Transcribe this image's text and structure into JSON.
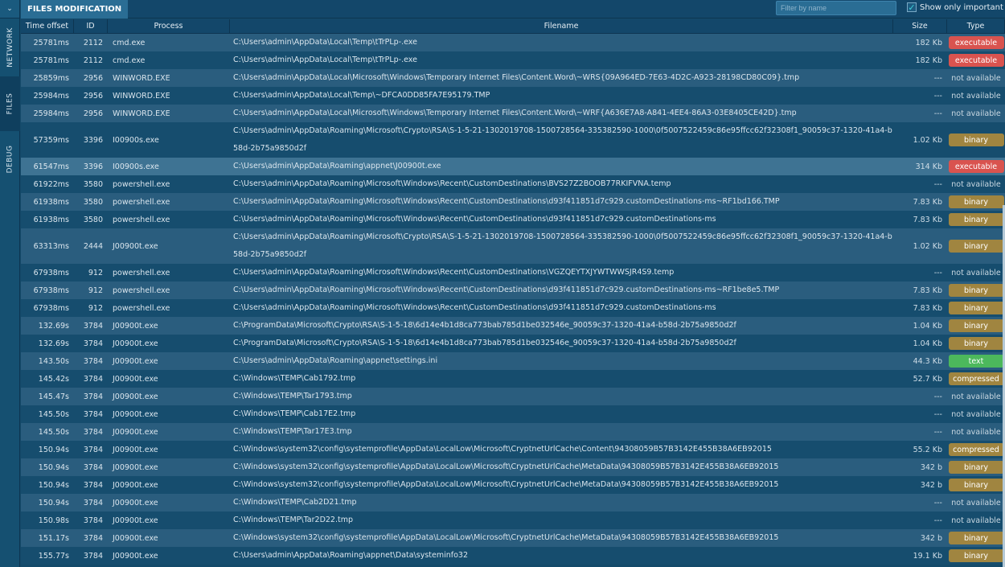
{
  "sidebar": {
    "collapse_icon": "chevron-down-icon",
    "tabs": [
      {
        "label": "NETWORK",
        "active": false
      },
      {
        "label": "FILES",
        "active": true
      },
      {
        "label": "DEBUG",
        "active": false
      }
    ]
  },
  "toolbar": {
    "tab_label": "FILES MODIFICATION",
    "filter_placeholder": "Filter by name",
    "filter_value": "",
    "show_important_label": "Show only important",
    "show_important_checked": true
  },
  "table": {
    "columns": [
      "Time offset",
      "ID",
      "Process",
      "Filename",
      "Size",
      "Type"
    ],
    "badge_colors": {
      "executable": "#d9534f",
      "binary": "#a08540",
      "compressed": "#a08540",
      "text": "#4cb85c"
    },
    "rows": [
      {
        "time": "25781ms",
        "id": "2112",
        "process": "cmd.exe",
        "filename": "C:\\Users\\admin\\AppData\\Local\\Temp\\tTrPLp-.exe",
        "size": "182 Kb",
        "type": "executable"
      },
      {
        "time": "25781ms",
        "id": "2112",
        "process": "cmd.exe",
        "filename": "C:\\Users\\admin\\AppData\\Local\\Temp\\tTrPLp-.exe",
        "size": "182 Kb",
        "type": "executable"
      },
      {
        "time": "25859ms",
        "id": "2956",
        "process": "WINWORD.EXE",
        "filename": "C:\\Users\\admin\\AppData\\Local\\Microsoft\\Windows\\Temporary Internet Files\\Content.Word\\~WRS{09A964ED-7E63-4D2C-A923-28198CD80C09}.tmp",
        "size": "---",
        "type": "not available"
      },
      {
        "time": "25984ms",
        "id": "2956",
        "process": "WINWORD.EXE",
        "filename": "C:\\Users\\admin\\AppData\\Local\\Temp\\~DFCA0DD85FA7E95179.TMP",
        "size": "---",
        "type": "not available"
      },
      {
        "time": "25984ms",
        "id": "2956",
        "process": "WINWORD.EXE",
        "filename": "C:\\Users\\admin\\AppData\\Local\\Microsoft\\Windows\\Temporary Internet Files\\Content.Word\\~WRF{A636E7A8-A841-4EE4-86A3-03E8405CE42D}.tmp",
        "size": "---",
        "type": "not available"
      },
      {
        "time": "57359ms",
        "id": "3396",
        "process": "I00900s.exe",
        "filename": "C:\\Users\\admin\\AppData\\Roaming\\Microsoft\\Crypto\\RSA\\S-1-5-21-1302019708-1500728564-335382590-1000\\0f5007522459c86e95ffcc62f32308f1_90059c37-1320-41a4-b58d-2b75a9850d2f",
        "size": "1.02 Kb",
        "type": "binary",
        "tall": true
      },
      {
        "time": "61547ms",
        "id": "3396",
        "process": "I00900s.exe",
        "filename": "C:\\Users\\admin\\AppData\\Roaming\\appnet\\J00900t.exe",
        "size": "314 Kb",
        "type": "executable",
        "selected": true
      },
      {
        "time": "61922ms",
        "id": "3580",
        "process": "powershell.exe",
        "filename": "C:\\Users\\admin\\AppData\\Roaming\\Microsoft\\Windows\\Recent\\CustomDestinations\\BVS27Z2BOOB77RKIFVNA.temp",
        "size": "---",
        "type": "not available"
      },
      {
        "time": "61938ms",
        "id": "3580",
        "process": "powershell.exe",
        "filename": "C:\\Users\\admin\\AppData\\Roaming\\Microsoft\\Windows\\Recent\\CustomDestinations\\d93f411851d7c929.customDestinations-ms~RF1bd166.TMP",
        "size": "7.83 Kb",
        "type": "binary"
      },
      {
        "time": "61938ms",
        "id": "3580",
        "process": "powershell.exe",
        "filename": "C:\\Users\\admin\\AppData\\Roaming\\Microsoft\\Windows\\Recent\\CustomDestinations\\d93f411851d7c929.customDestinations-ms",
        "size": "7.83 Kb",
        "type": "binary"
      },
      {
        "time": "63313ms",
        "id": "2444",
        "process": "J00900t.exe",
        "filename": "C:\\Users\\admin\\AppData\\Roaming\\Microsoft\\Crypto\\RSA\\S-1-5-21-1302019708-1500728564-335382590-1000\\0f5007522459c86e95ffcc62f32308f1_90059c37-1320-41a4-b58d-2b75a9850d2f",
        "size": "1.02 Kb",
        "type": "binary",
        "tall": true
      },
      {
        "time": "67938ms",
        "id": "912",
        "process": "powershell.exe",
        "filename": "C:\\Users\\admin\\AppData\\Roaming\\Microsoft\\Windows\\Recent\\CustomDestinations\\VGZQEYTXJYWTWWSJR4S9.temp",
        "size": "---",
        "type": "not available"
      },
      {
        "time": "67938ms",
        "id": "912",
        "process": "powershell.exe",
        "filename": "C:\\Users\\admin\\AppData\\Roaming\\Microsoft\\Windows\\Recent\\CustomDestinations\\d93f411851d7c929.customDestinations-ms~RF1be8e5.TMP",
        "size": "7.83 Kb",
        "type": "binary"
      },
      {
        "time": "67938ms",
        "id": "912",
        "process": "powershell.exe",
        "filename": "C:\\Users\\admin\\AppData\\Roaming\\Microsoft\\Windows\\Recent\\CustomDestinations\\d93f411851d7c929.customDestinations-ms",
        "size": "7.83 Kb",
        "type": "binary"
      },
      {
        "time": "132.69s",
        "id": "3784",
        "process": "J00900t.exe",
        "filename": "C:\\ProgramData\\Microsoft\\Crypto\\RSA\\S-1-5-18\\6d14e4b1d8ca773bab785d1be032546e_90059c37-1320-41a4-b58d-2b75a9850d2f",
        "size": "1.04 Kb",
        "type": "binary"
      },
      {
        "time": "132.69s",
        "id": "3784",
        "process": "J00900t.exe",
        "filename": "C:\\ProgramData\\Microsoft\\Crypto\\RSA\\S-1-5-18\\6d14e4b1d8ca773bab785d1be032546e_90059c37-1320-41a4-b58d-2b75a9850d2f",
        "size": "1.04 Kb",
        "type": "binary"
      },
      {
        "time": "143.50s",
        "id": "3784",
        "process": "J00900t.exe",
        "filename": "C:\\Users\\admin\\AppData\\Roaming\\appnet\\settings.ini",
        "size": "44.3 Kb",
        "type": "text"
      },
      {
        "time": "145.42s",
        "id": "3784",
        "process": "J00900t.exe",
        "filename": "C:\\Windows\\TEMP\\Cab1792.tmp",
        "size": "52.7 Kb",
        "type": "compressed"
      },
      {
        "time": "145.47s",
        "id": "3784",
        "process": "J00900t.exe",
        "filename": "C:\\Windows\\TEMP\\Tar1793.tmp",
        "size": "---",
        "type": "not available"
      },
      {
        "time": "145.50s",
        "id": "3784",
        "process": "J00900t.exe",
        "filename": "C:\\Windows\\TEMP\\Cab17E2.tmp",
        "size": "---",
        "type": "not available"
      },
      {
        "time": "145.50s",
        "id": "3784",
        "process": "J00900t.exe",
        "filename": "C:\\Windows\\TEMP\\Tar17E3.tmp",
        "size": "---",
        "type": "not available"
      },
      {
        "time": "150.94s",
        "id": "3784",
        "process": "J00900t.exe",
        "filename": "C:\\Windows\\system32\\config\\systemprofile\\AppData\\LocalLow\\Microsoft\\CryptnetUrlCache\\Content\\94308059B57B3142E455B38A6EB92015",
        "size": "55.2 Kb",
        "type": "compressed"
      },
      {
        "time": "150.94s",
        "id": "3784",
        "process": "J00900t.exe",
        "filename": "C:\\Windows\\system32\\config\\systemprofile\\AppData\\LocalLow\\Microsoft\\CryptnetUrlCache\\MetaData\\94308059B57B3142E455B38A6EB92015",
        "size": "342 b",
        "type": "binary"
      },
      {
        "time": "150.94s",
        "id": "3784",
        "process": "J00900t.exe",
        "filename": "C:\\Windows\\system32\\config\\systemprofile\\AppData\\LocalLow\\Microsoft\\CryptnetUrlCache\\MetaData\\94308059B57B3142E455B38A6EB92015",
        "size": "342 b",
        "type": "binary"
      },
      {
        "time": "150.94s",
        "id": "3784",
        "process": "J00900t.exe",
        "filename": "C:\\Windows\\TEMP\\Cab2D21.tmp",
        "size": "---",
        "type": "not available"
      },
      {
        "time": "150.98s",
        "id": "3784",
        "process": "J00900t.exe",
        "filename": "C:\\Windows\\TEMP\\Tar2D22.tmp",
        "size": "---",
        "type": "not available"
      },
      {
        "time": "151.17s",
        "id": "3784",
        "process": "J00900t.exe",
        "filename": "C:\\Windows\\system32\\config\\systemprofile\\AppData\\LocalLow\\Microsoft\\CryptnetUrlCache\\MetaData\\94308059B57B3142E455B38A6EB92015",
        "size": "342 b",
        "type": "binary"
      },
      {
        "time": "155.77s",
        "id": "3784",
        "process": "J00900t.exe",
        "filename": "C:\\Users\\admin\\AppData\\Roaming\\appnet\\Data\\systeminfo32",
        "size": "19.1 Kb",
        "type": "binary"
      }
    ]
  }
}
